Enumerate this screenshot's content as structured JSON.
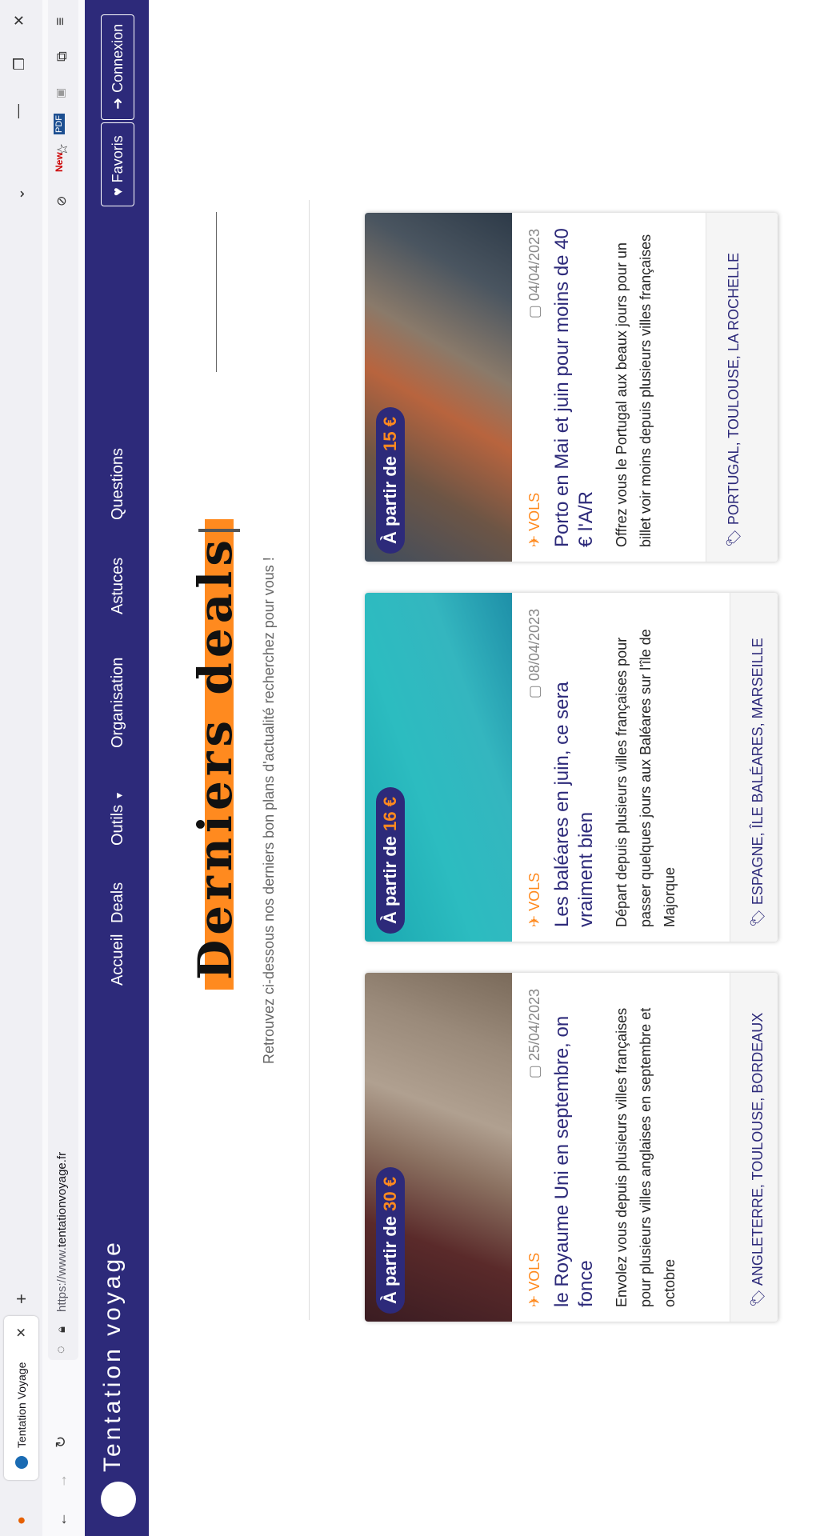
{
  "browser": {
    "tab_title": "Tentation Voyage",
    "url_prefix": "https://www.",
    "url_domain": "tentationvoyage.fr"
  },
  "site": {
    "brand": "Tentation voyage",
    "nav": [
      "Accueil",
      "Deals",
      "Outils",
      "Organisation",
      "Astuces",
      "Questions"
    ],
    "favorites_label": "Favoris",
    "login_label": "Connexion"
  },
  "hero": {
    "title": "Derniers deals",
    "subtitle": "Retrouvez ci-dessous nos derniers bon plans d'actualité recherchez pour vous !"
  },
  "cards": [
    {
      "price_prefix": "À partir de ",
      "price": "30 €",
      "category": "VOLS",
      "date": "25/04/2023",
      "title": "le Royaume Uni en septembre, on fonce",
      "description": "Envolez vous depuis plusieurs villes françaises pour plusieurs villes anglaises en septembre et octobre",
      "tags": "ANGLETERRE, TOULOUSE, BORDEAUX"
    },
    {
      "price_prefix": "À partir de ",
      "price": "16 €",
      "category": "VOLS",
      "date": "08/04/2023",
      "title": "Les baléares en juin, ce sera vraiment bien",
      "description": "Départ depuis plusieurs villes françaises pour passer quelques jours aux Baléares sur l'île de Majorque",
      "tags": "ESPAGNE, ÎLE BALÉARES, MARSEILLE"
    },
    {
      "price_prefix": "À partir de ",
      "price": "15 €",
      "category": "VOLS",
      "date": "04/04/2023",
      "title": "Porto en Mai et juin pour moins de 40 € l'A/R",
      "description": "Offrez vous le Portugal aux beaux jours pour un billet voir moins depuis plusieurs villes françaises",
      "tags": "PORTUGAL, TOULOUSE, LA ROCHELLE"
    }
  ]
}
